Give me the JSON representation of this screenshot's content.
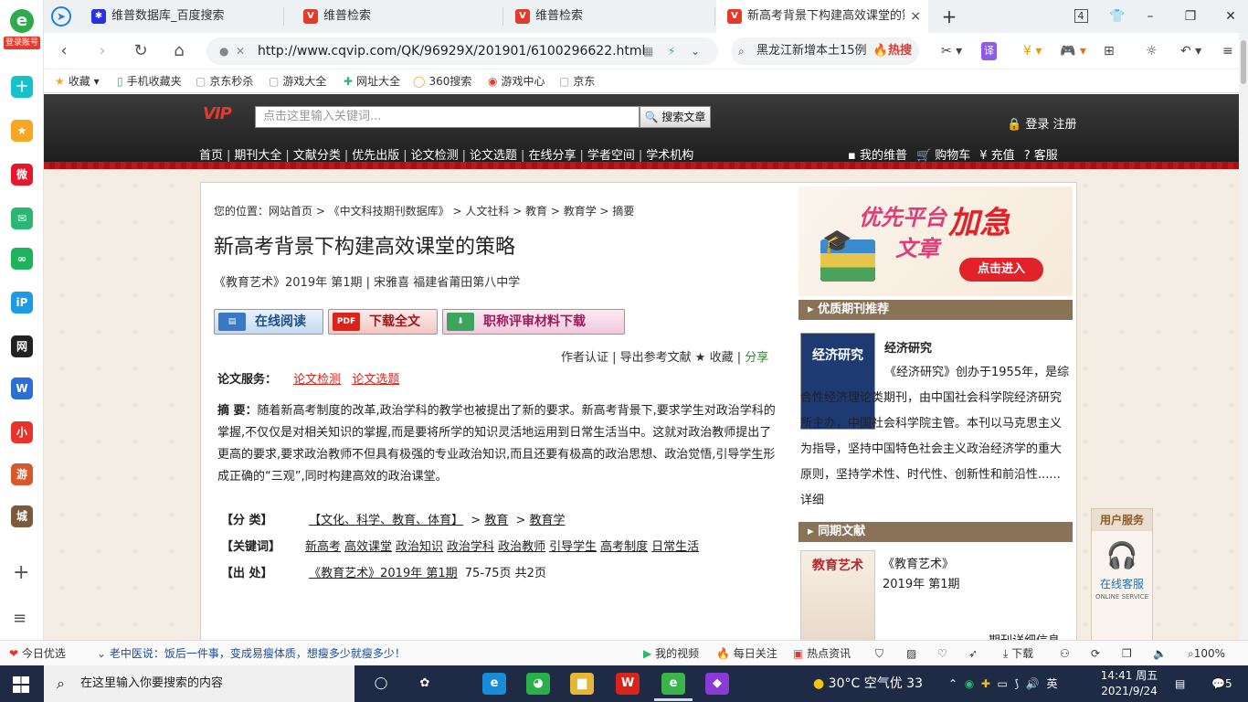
{
  "sidebar": {
    "login_label": "登录账号",
    "icons": [
      {
        "name": "plus-icon",
        "glyph": "十",
        "color": "#16c1c8"
      },
      {
        "name": "star-icon",
        "glyph": "★",
        "color": "#f5a623"
      },
      {
        "name": "weibo-icon",
        "glyph": "微",
        "color": "#e6162d"
      },
      {
        "name": "mail-icon",
        "glyph": "✉",
        "color": "#2bb673"
      },
      {
        "name": "link-icon",
        "glyph": "∞",
        "color": "#1fb35e"
      },
      {
        "name": "ip-icon",
        "glyph": "iP",
        "color": "#1c9be6"
      },
      {
        "name": "game-news-icon",
        "glyph": "网",
        "color": "#222222"
      },
      {
        "name": "word-icon",
        "glyph": "W",
        "color": "#2b6fd6"
      },
      {
        "name": "xiaohongshu-icon",
        "glyph": "小",
        "color": "#e8332a"
      },
      {
        "name": "game-icon",
        "glyph": "游",
        "color": "#d9582b"
      },
      {
        "name": "castle-icon",
        "glyph": "城",
        "color": "#7a5a3a"
      }
    ],
    "add_glyph": "+",
    "menu_glyph": "≡"
  },
  "tabs": [
    {
      "label": "维普数据库_百度搜索",
      "icon": "baidu-paw-icon",
      "icon_color": "#2932e1"
    },
    {
      "label": "维普检索",
      "icon": "vip-icon",
      "icon_color": "#e23b2b"
    },
    {
      "label": "维普检索",
      "icon": "vip-icon",
      "icon_color": "#e23b2b"
    },
    {
      "label": "新高考背景下构建高效课堂的策略",
      "icon": "vip-icon",
      "icon_color": "#e23b2b"
    }
  ],
  "tab_close": "×",
  "new_tab": "+",
  "tab_count": "4",
  "window": {
    "minimize": "–",
    "restore": "❐",
    "close": "✕"
  },
  "address": {
    "url": "http://www.cqvip.com/QK/96929X/201901/6100296622.html",
    "search_query": "黑龙江新增本土15例",
    "search_hot": "🔥热搜"
  },
  "bookmarks": [
    {
      "icon": "★",
      "label": "收藏 ▾"
    },
    {
      "icon": "▯",
      "label": "手机收藏夹"
    },
    {
      "icon": "▢",
      "label": "京东秒杀"
    },
    {
      "icon": "▢",
      "label": "游戏大全"
    },
    {
      "icon": "✚",
      "label": "网址大全"
    },
    {
      "icon": "◯",
      "label": "360搜索"
    },
    {
      "icon": "◉",
      "label": "游戏中心"
    },
    {
      "icon": "▢",
      "label": "京东"
    }
  ],
  "vip": {
    "logo": "VIP",
    "search_placeholder": "点击这里输入关键词...",
    "search_button": "🔍 搜索文章",
    "login": "🔒 登录 注册",
    "nav": [
      "首页",
      "期刊大全",
      "文献分类",
      "优先出版",
      "论文检测",
      "论文选题",
      "在线分享",
      "学者空间",
      "学术机构"
    ],
    "user_links": [
      "▪ 我的维普",
      "🛒 购物车",
      "¥ 充值",
      "? 客服"
    ]
  },
  "article": {
    "breadcrumb": "您的位置：网站首页 > 《中文科技期刊数据库》 > 人文社科 > 教育 > 教育学 > 摘要",
    "title": "新高考背景下构建高效课堂的策略",
    "meta": "《教育艺术》2019年 第1期 | 宋雅喜   福建省莆田第八中学",
    "buttons": {
      "read": "在线阅读",
      "download": "下载全文",
      "eval": "职称评审材料下载"
    },
    "tools": "作者认证 | 导出参考文献 ★ 收藏 | ",
    "share": "分享",
    "services_label": "论文服务：",
    "services": [
      "论文检测",
      "论文选题"
    ],
    "abstract_label": "摘   要：",
    "abstract": "随着新高考制度的改革,政治学科的教学也被提出了新的要求。新高考背景下,要求学生对政治学科的掌握,不仅仅是对相关知识的掌握,而是要将所学的知识灵活地运用到日常生活当中。这就对政治教师提出了更高的要求,要求政治教师不但具有极强的专业政治知识,而且还要有极高的政治思想、政治觉悟,引导学生形成正确的“三观”,同时构建高效的政治课堂。",
    "classification_label": "【分   类】",
    "classification": [
      "【文化、科学、教育、体育】",
      " > ",
      "教育",
      " > ",
      "教育学"
    ],
    "keywords_label": "【关键词】",
    "keywords": [
      "新高考",
      "高效课堂",
      "政治知识",
      "政治学科",
      "政治教师",
      "引导学生",
      "高考制度",
      "日常生活"
    ],
    "source_label": "【出   处】",
    "source_link": "《教育艺术》2019年 第1期",
    "source_pages": " 75-75页 共2页"
  },
  "right": {
    "ad": {
      "line1": "优先平台",
      "line2": "加急",
      "line3": "文章",
      "cta": "点击进入"
    },
    "recommend_head": "优质期刊推荐",
    "journal_cover": "经济研究",
    "journal_name": "经济研究",
    "journal_desc": "《经济研究》创办于1955年，是综合性经济理论类期刊，由中国社会科学院经济研究所主办，中国社会科学院主管。本刊以马克思主义为指导，坚持中国特色社会主义政治经济学的重大原则，坚持学术性、时代性、创新性和前沿性......详细",
    "same_head": "同期文献",
    "issue_cover": "教育艺术",
    "issue_name": "《教育艺术》",
    "issue_no": "2019年 第1期",
    "issue_more": "期刊详细信息"
  },
  "user_service": {
    "head": "用户服务",
    "label": "在线客服",
    "sub": "ONLINE SERVICE"
  },
  "status": {
    "today": "今日优选",
    "news": "老中医说：饭后一件事，变成易瘦体质，想瘦多少就瘦多少！",
    "video": "我的视频",
    "daily": "每日关注",
    "hot": "热点资讯",
    "download": "下载",
    "zoom": "100%"
  },
  "taskbar": {
    "search_placeholder": "在这里输入你要搜索的内容",
    "weather": "30°C 空气优 33",
    "ime": "英",
    "time": "14:41 周五",
    "date": "2021/9/24",
    "notif": "5",
    "apps": [
      {
        "name": "task-view-icon",
        "glyph": "◯",
        "color": "transparent"
      },
      {
        "name": "pinwheel-icon",
        "glyph": "✿",
        "color": "transparent"
      },
      {
        "name": "edge-browser-icon",
        "glyph": "e",
        "color": "#1a8bd6"
      },
      {
        "name": "wechat-icon",
        "glyph": "◕",
        "color": "#2ab04a"
      },
      {
        "name": "file-explorer-icon",
        "glyph": "▆",
        "color": "#e6b63b"
      },
      {
        "name": "wps-icon",
        "glyph": "W",
        "color": "#d9241c"
      },
      {
        "name": "browser-360-icon",
        "glyph": "e",
        "color": "#3bb54a"
      },
      {
        "name": "colorful-drop-icon",
        "glyph": "◆",
        "color": "#8a3bd6"
      }
    ]
  }
}
